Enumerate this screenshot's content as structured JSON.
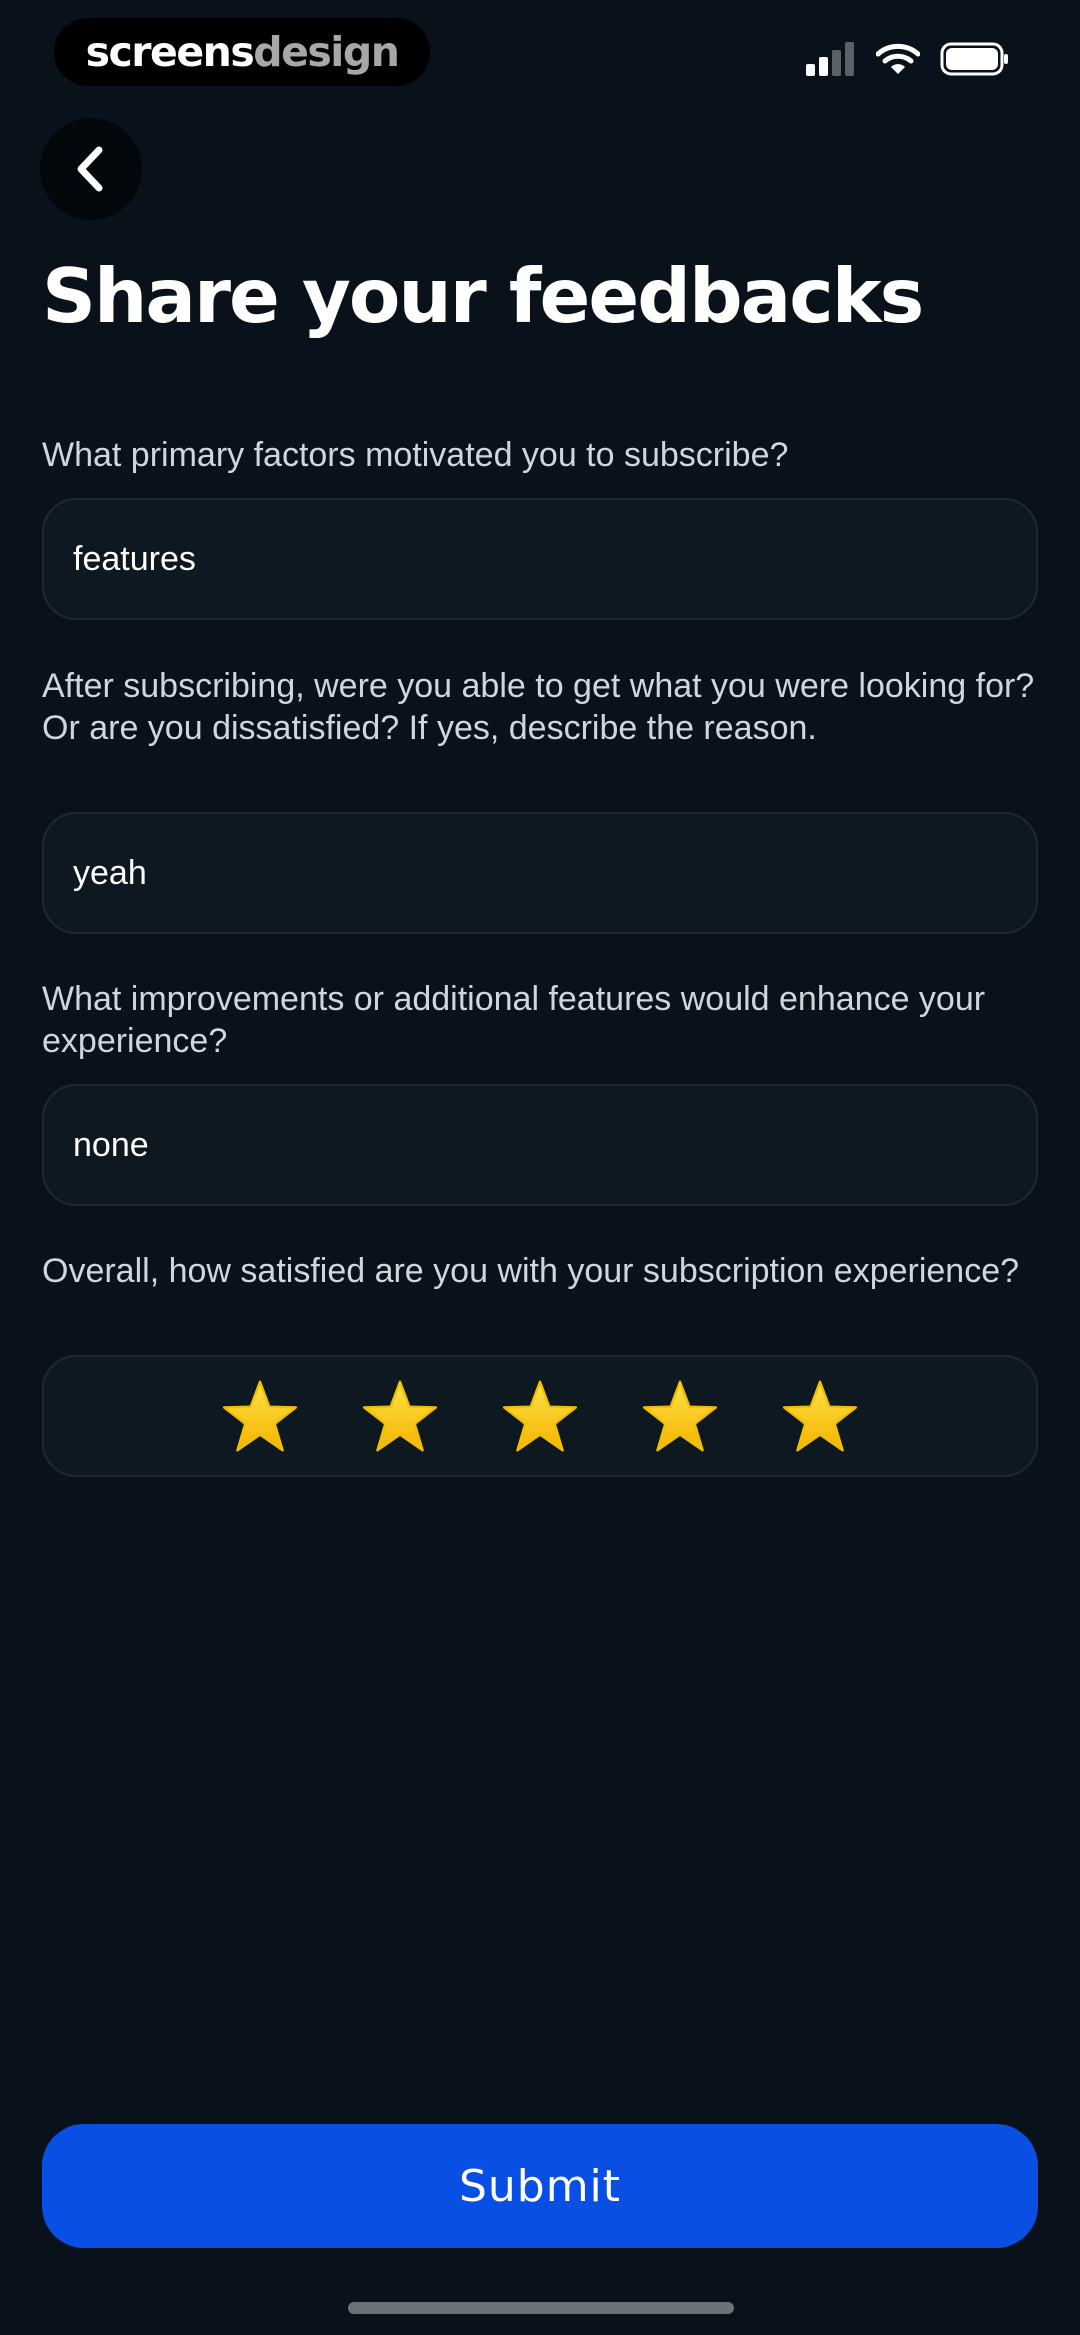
{
  "status_bar": {
    "brand_part1": "screens",
    "brand_part2": "design",
    "icons": [
      "cellular-signal-icon",
      "wifi-icon",
      "battery-icon"
    ]
  },
  "header": {
    "back_icon": "chevron-left-icon",
    "title": "Share your feedbacks"
  },
  "form": {
    "questions": [
      {
        "label": "What primary factors motivated you to subscribe?",
        "value": "features"
      },
      {
        "label": "After subscribing, were you able to get what you were looking for? Or are you dissatisfied? If yes, describe the reason.",
        "value": "yeah"
      },
      {
        "label": "What improvements or additional features would enhance your experience?",
        "value": "none"
      }
    ],
    "rating": {
      "label": "Overall, how satisfied are you with your subscription experience?",
      "value": 5,
      "max": 5
    }
  },
  "submit_label": "Submit",
  "colors": {
    "background": "#09121b",
    "field_background": "#0e1820",
    "accent": "#0a4fe3",
    "star": "#ffd83a"
  }
}
